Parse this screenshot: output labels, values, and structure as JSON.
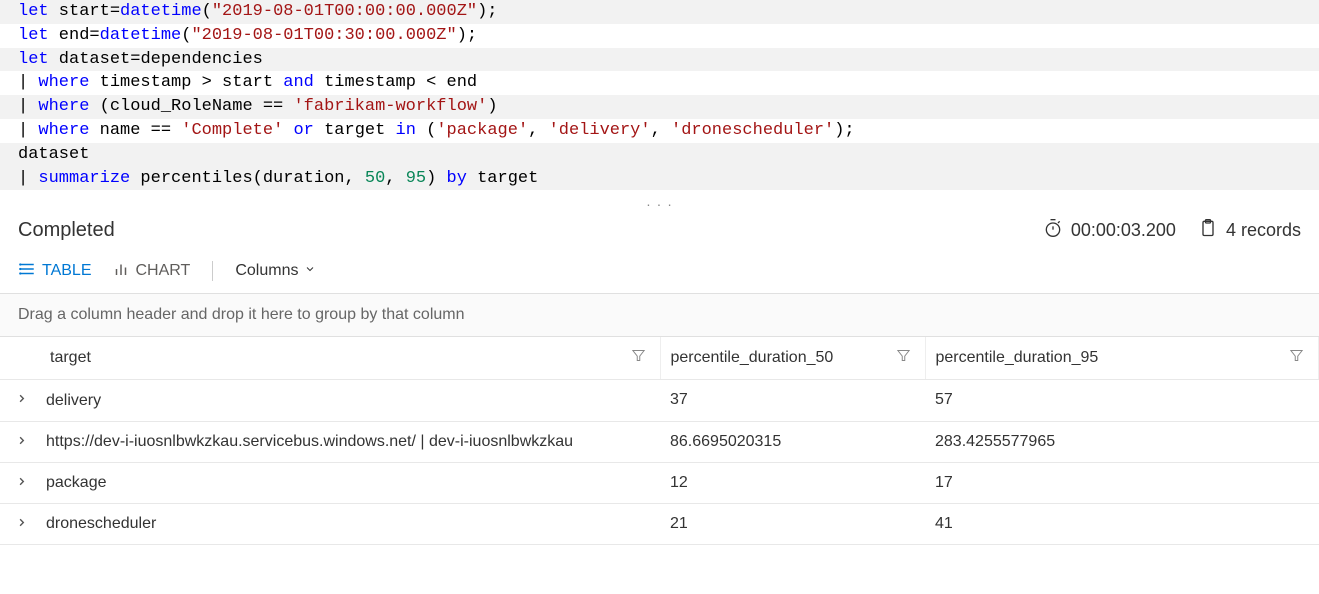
{
  "query": {
    "lines": [
      {
        "banded": true,
        "tokens": [
          {
            "t": "kw",
            "v": "let"
          },
          {
            "t": "ident",
            "v": " start"
          },
          {
            "t": "op",
            "v": "="
          },
          {
            "t": "fn",
            "v": "datetime"
          },
          {
            "t": "op",
            "v": "("
          },
          {
            "t": "str",
            "v": "\"2019-08-01T00:00:00.000Z\""
          },
          {
            "t": "op",
            "v": ");"
          }
        ]
      },
      {
        "banded": false,
        "tokens": [
          {
            "t": "kw",
            "v": "let"
          },
          {
            "t": "ident",
            "v": " end"
          },
          {
            "t": "op",
            "v": "="
          },
          {
            "t": "fn",
            "v": "datetime"
          },
          {
            "t": "op",
            "v": "("
          },
          {
            "t": "str",
            "v": "\"2019-08-01T00:30:00.000Z\""
          },
          {
            "t": "op",
            "v": ");"
          }
        ]
      },
      {
        "banded": true,
        "tokens": [
          {
            "t": "kw",
            "v": "let"
          },
          {
            "t": "ident",
            "v": " dataset"
          },
          {
            "t": "op",
            "v": "="
          },
          {
            "t": "ident",
            "v": "dependencies"
          }
        ]
      },
      {
        "banded": false,
        "tokens": [
          {
            "t": "pipe",
            "v": "| "
          },
          {
            "t": "kw",
            "v": "where"
          },
          {
            "t": "ident",
            "v": " timestamp "
          },
          {
            "t": "op",
            "v": "> "
          },
          {
            "t": "ident",
            "v": "start "
          },
          {
            "t": "kw",
            "v": "and"
          },
          {
            "t": "ident",
            "v": " timestamp "
          },
          {
            "t": "op",
            "v": "< "
          },
          {
            "t": "ident",
            "v": "end"
          }
        ]
      },
      {
        "banded": true,
        "tokens": [
          {
            "t": "pipe",
            "v": "| "
          },
          {
            "t": "kw",
            "v": "where"
          },
          {
            "t": "ident",
            "v": " (cloud_RoleName "
          },
          {
            "t": "op",
            "v": "== "
          },
          {
            "t": "str",
            "v": "'fabrikam-workflow'"
          },
          {
            "t": "op",
            "v": ")"
          }
        ]
      },
      {
        "banded": false,
        "tokens": [
          {
            "t": "pipe",
            "v": "| "
          },
          {
            "t": "kw",
            "v": "where"
          },
          {
            "t": "ident",
            "v": " name "
          },
          {
            "t": "op",
            "v": "== "
          },
          {
            "t": "str",
            "v": "'Complete'"
          },
          {
            "t": "ident",
            "v": " "
          },
          {
            "t": "kw",
            "v": "or"
          },
          {
            "t": "ident",
            "v": " target "
          },
          {
            "t": "kw",
            "v": "in"
          },
          {
            "t": "op",
            "v": " ("
          },
          {
            "t": "str",
            "v": "'package'"
          },
          {
            "t": "op",
            "v": ", "
          },
          {
            "t": "str",
            "v": "'delivery'"
          },
          {
            "t": "op",
            "v": ", "
          },
          {
            "t": "str",
            "v": "'dronescheduler'"
          },
          {
            "t": "op",
            "v": ");"
          }
        ]
      },
      {
        "banded": true,
        "tokens": [
          {
            "t": "ident",
            "v": "dataset"
          }
        ]
      },
      {
        "banded": true,
        "tokens": [
          {
            "t": "pipe",
            "v": "| "
          },
          {
            "t": "kw",
            "v": "summarize"
          },
          {
            "t": "ident",
            "v": " percentiles(duration, "
          },
          {
            "t": "num",
            "v": "50"
          },
          {
            "t": "op",
            "v": ", "
          },
          {
            "t": "num",
            "v": "95"
          },
          {
            "t": "op",
            "v": ") "
          },
          {
            "t": "kw",
            "v": "by"
          },
          {
            "t": "ident",
            "v": " target"
          }
        ]
      }
    ]
  },
  "status": {
    "text": "Completed",
    "duration": "00:00:03.200",
    "records": "4 records"
  },
  "tabs": {
    "table_label": "TABLE",
    "chart_label": "CHART",
    "columns_label": "Columns"
  },
  "grid": {
    "group_hint": "Drag a column header and drop it here to group by that column",
    "columns": [
      "target",
      "percentile_duration_50",
      "percentile_duration_95"
    ],
    "rows": [
      {
        "target": "delivery",
        "p50": "37",
        "p95": "57"
      },
      {
        "target": "https://dev-i-iuosnlbwkzkau.servicebus.windows.net/ | dev-i-iuosnlbwkzkau",
        "p50": "86.6695020315",
        "p95": "283.4255577965"
      },
      {
        "target": "package",
        "p50": "12",
        "p95": "17"
      },
      {
        "target": "dronescheduler",
        "p50": "21",
        "p95": "41"
      }
    ]
  }
}
